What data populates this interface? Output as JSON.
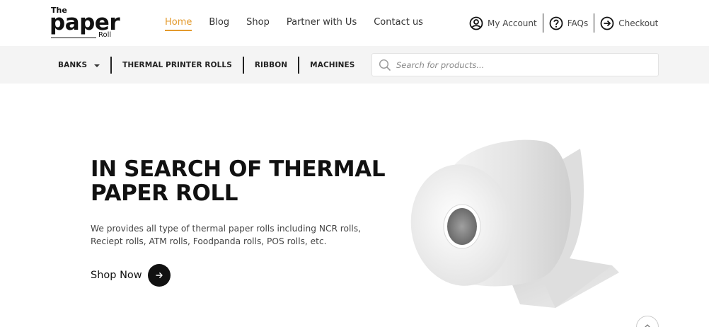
{
  "logo": {
    "line1": "The",
    "line2": "paper",
    "line3": "Roll"
  },
  "nav": {
    "items": [
      {
        "label": "Home",
        "active": true
      },
      {
        "label": "Blog",
        "active": false
      },
      {
        "label": "Shop",
        "active": false
      },
      {
        "label": "Partner with Us",
        "active": false
      },
      {
        "label": "Contact us",
        "active": false
      }
    ]
  },
  "account": {
    "my_account": "My Account",
    "faqs": "FAQs",
    "checkout": "Checkout"
  },
  "categories": [
    {
      "label": "BANKS",
      "has_dropdown": true
    },
    {
      "label": "THERMAL PRINTER ROLLS",
      "has_dropdown": false
    },
    {
      "label": "RIBBON",
      "has_dropdown": false
    },
    {
      "label": "MACHINES",
      "has_dropdown": false
    }
  ],
  "search": {
    "placeholder": "Search for products..."
  },
  "hero": {
    "title": "IN SEARCH OF THERMAL PAPER ROLL",
    "description": "We provides all type of thermal paper rolls including NCR rolls, Reciept rolls, ATM rolls, Foodpanda rolls, POS rolls, etc.",
    "cta_label": "Shop Now"
  },
  "colors": {
    "accent": "#e39a2d",
    "text": "#111111",
    "subbar_bg": "#f4f4f4"
  },
  "icons": [
    "user-circle-icon",
    "question-circle-icon",
    "arrow-circle-right-icon",
    "search-icon",
    "arrow-right-icon",
    "chevron-up-icon"
  ]
}
